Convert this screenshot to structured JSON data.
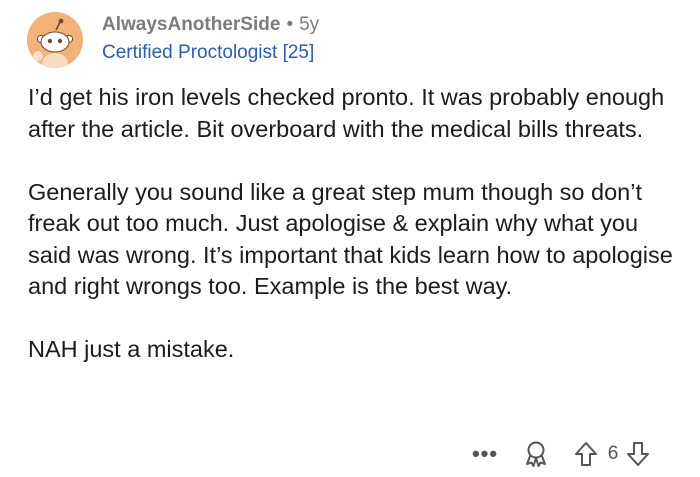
{
  "comment": {
    "username": "AlwaysAnotherSide",
    "separator": "•",
    "age": "5y",
    "flair": "Certified Proctologist [25]",
    "paragraphs": [
      "I’d get his iron levels checked pronto. It was probably enough after the article. Bit overboard with the medical bills threats.",
      "Generally you sound like a great step mum though so don’t freak out too much. Just apologise & explain why what you said was wrong. It’s important that kids learn how to apologise and right wrongs too. Example is the best way.",
      "NAH just a mistake."
    ]
  },
  "actions": {
    "more_label": "•••",
    "score": "6",
    "icons": [
      "more-options-icon",
      "award-icon",
      "upvote-icon",
      "downvote-icon"
    ]
  },
  "colors": {
    "avatar_bg": "#f2b27a",
    "flair_text": "#2a5db0",
    "meta_text": "#7c7c7c"
  }
}
